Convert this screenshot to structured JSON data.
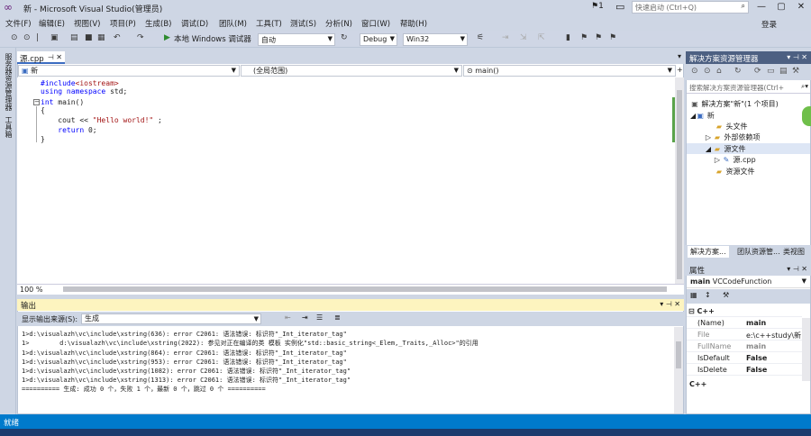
{
  "window": {
    "title": "新 - Microsoft Visual Studio(管理员)",
    "notification_count": "1",
    "quick_launch_placeholder": "快速启动 (Ctrl+Q)",
    "login_label": "登录"
  },
  "menu": [
    "文件(F)",
    "编辑(E)",
    "视图(V)",
    "项目(P)",
    "生成(B)",
    "调试(D)",
    "团队(M)",
    "工具(T)",
    "测试(S)",
    "分析(N)",
    "窗口(W)",
    "帮助(H)"
  ],
  "toolbar": {
    "debugger_label": "本地 Windows 调试器",
    "auto_combo": "自动",
    "config_combo": "Debug",
    "platform_combo": "Win32"
  },
  "left_strip": {
    "server_explorer": "服务器资源管理器",
    "toolbox": "工具箱"
  },
  "editor": {
    "tab_label": "源.cpp",
    "nav_project": "新",
    "nav_scope": "(全局范围)",
    "nav_member": "main()",
    "zoom": "100 %",
    "code_lines": [
      {
        "a": "#include",
        "b": "<iostream>",
        "c": ""
      },
      {
        "a": "using namespace",
        "b": " std;",
        "c": ""
      },
      {
        "a": "int",
        "b": " main()",
        "c": ""
      },
      {
        "a": "{",
        "b": "",
        "c": ""
      },
      {
        "a": "    cout << ",
        "b": "\"Hello world!\"",
        "c": " ;"
      },
      {
        "a": "    return",
        "b": " 0;",
        "c": ""
      },
      {
        "a": "}",
        "b": "",
        "c": ""
      }
    ]
  },
  "output": {
    "title": "输出",
    "source_label": "显示输出来源(S):",
    "source_value": "生成",
    "lines": [
      "1>d:\\visualazh\\vc\\include\\xstring(636): error C2061: 语法错误: 标识符\"_Int_iterator_tag\"",
      "1>        d:\\visualazh\\vc\\include\\xstring(2022): 参见对正在编译的类 模板 实例化\"std::basic_string<_Elem,_Traits,_Alloc>\"的引用",
      "1>d:\\visualazh\\vc\\include\\xstring(864): error C2061: 语法错误: 标识符\"_Int_iterator_tag\"",
      "1>d:\\visualazh\\vc\\include\\xstring(953): error C2061: 语法错误: 标识符\"_Int_iterator_tag\"",
      "1>d:\\visualazh\\vc\\include\\xstring(1082): error C2061: 语法错误: 标识符\"_Int_iterator_tag\"",
      "1>d:\\visualazh\\vc\\include\\xstring(1313): error C2061: 语法错误: 标识符\"_Int_iterator_tag\"",
      "========== 生成: 成功 0 个，失败 1 个，最新 0 个，跳过 0 个 =========="
    ]
  },
  "solution_explorer": {
    "title": "解决方案资源管理器",
    "search_placeholder": "搜索解决方案资源管理器(Ctrl+",
    "tree": [
      {
        "label": "解决方案\"新\"(1 个项目)",
        "indent": 0,
        "icon": "solution-icon"
      },
      {
        "label": "新",
        "indent": 1,
        "icon": "project-icon"
      },
      {
        "label": "头文件",
        "indent": 2,
        "icon": "folder-icon"
      },
      {
        "label": "外部依赖项",
        "indent": 2,
        "icon": "folder-icon"
      },
      {
        "label": "源文件",
        "indent": 2,
        "icon": "folder-icon"
      },
      {
        "label": "源.cpp",
        "indent": 3,
        "icon": "cpp-file-icon"
      },
      {
        "label": "资源文件",
        "indent": 2,
        "icon": "folder-icon"
      }
    ],
    "tabs": [
      "解决方案...",
      "团队资源管...",
      "类视图"
    ]
  },
  "properties": {
    "title": "属性",
    "object_name": "main",
    "object_type": "VCCodeFunction",
    "category": "C++",
    "rows": [
      {
        "key": "(Name)",
        "value": "main"
      },
      {
        "key": "File",
        "value": "e:\\c++study\\新"
      },
      {
        "key": "FullName",
        "value": "main"
      },
      {
        "key": "IsDefault",
        "value": "False"
      },
      {
        "key": "IsDelete",
        "value": "False"
      }
    ],
    "description_title": "C++"
  },
  "status": {
    "text": "就绪"
  }
}
